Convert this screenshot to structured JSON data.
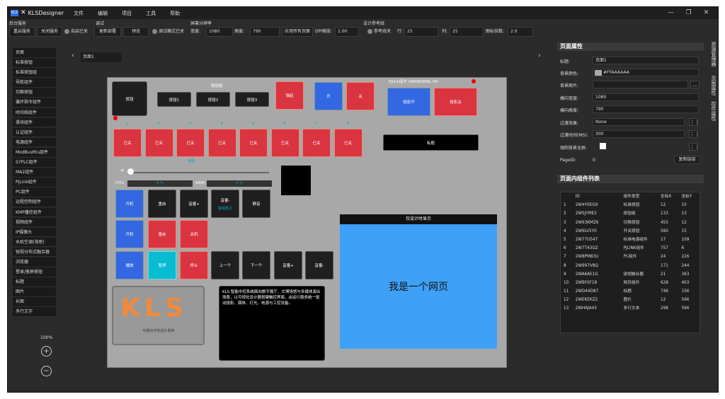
{
  "app": {
    "title": "KLSDesigner",
    "logo_text": "KLS",
    "menu": [
      "文件",
      "编辑",
      "项目",
      "工具",
      "帮助"
    ],
    "win_minimize": "—",
    "win_restore": "❐",
    "win_close": "✕"
  },
  "toolbar": {
    "service": {
      "label": "后台服务",
      "restart": "重启服务",
      "stop": "关闭服务",
      "auto_start": "自启已关"
    },
    "debug": {
      "label": "调试",
      "update_deploy": "更新部署",
      "preview": "预览",
      "debug_mode": "调试模式已关"
    },
    "resolution": {
      "label": "屏幕分辨率",
      "width_label": "宽度:",
      "width": "1080",
      "height_label": "高度:",
      "height": "790",
      "apply_all": "应用所有页面",
      "dpi_label": "DPI缩放:",
      "dpi": "1.00"
    },
    "guides": {
      "label": "设计参考线",
      "guides_toggle": "参考线关",
      "row_label": "行:",
      "rows": "25",
      "col_label": "列:",
      "cols": "25",
      "magnet_label": "图标倍数:",
      "magnet": "2.0"
    }
  },
  "sidebar": [
    "页面",
    "标准按钮",
    "标准按钮组",
    "导航组件",
    "切换按钮",
    "循环指令组件",
    "时间线组件",
    "滑块组件",
    "认证组件",
    "电源组件",
    "ModBusRtu组件",
    "S7PLC组件",
    "MA2组件",
    "PJLink组件",
    "PC组件",
    "远程控制组件",
    "KMP播控组件",
    "视频组件",
    "IP摄像头",
    "水机空调(海思)",
    "锐视分布式融合器",
    "浏览器",
    "登录/鉴屏按钮",
    "标题",
    "图片",
    "长图",
    "多行文字"
  ],
  "zoom": {
    "level": "100%",
    "in": "+",
    "out": "−"
  },
  "tabs": {
    "current": "页面1",
    "prev": "‹",
    "next": "›"
  },
  "canvas": {
    "btn_single": "按钮",
    "btn_group_title": "按钮组",
    "btn_group": [
      "按钮1",
      "按钮2",
      "按钮3"
    ],
    "popup": "弹起",
    "on": "开",
    "off": "关",
    "pjlink_status": "PJlink指令 UNKNOWNL 0H",
    "proj_on": "投影开",
    "proj_off": "投影关",
    "nums": [
      "1",
      "2",
      "3",
      "4",
      "5",
      "6",
      "7",
      "8"
    ],
    "states": [
      "已关",
      "已关",
      "已关",
      "已关",
      "已关",
      "已关",
      "已关",
      "已关"
    ],
    "power_label": "电源",
    "title_label": "标题",
    "cpu_label": "CPU:",
    "cpu_val": "0 %",
    "ram_label": "RAM:",
    "ram_val": "0 %",
    "pc_row1": [
      "开机",
      "重启",
      "音量+",
      "音量-",
      "静音"
    ],
    "volume_sub": "锐视盒子",
    "pc_row2": [
      "开机",
      "重启",
      "关机"
    ],
    "media_row": [
      "播放",
      "暂停",
      "停止",
      "上一个",
      "下一个",
      "音量+",
      "音量-"
    ],
    "browser_header": "仅设计时显示",
    "browser_text": "我是一个网页",
    "logo_text": "KLS",
    "logo_sub": "可视化中控设计系统",
    "multiline": "KLS 智能中控系统面向数字展厅、文博场馆与多媒体演出场景，以可视化设计器搭建触控界面，由运行服务统一驱动投影、媒体、灯光、电源与工控设备。"
  },
  "props": {
    "header": "页面属性",
    "title_label": "标题:",
    "title": "页面1",
    "bg_color_label": "背景颜色:",
    "bg_color": "#FFAAAAAA",
    "bg_image_label": "背景图片:",
    "bg_image": "",
    "browse": "...",
    "w_label": "横向宽度:",
    "w": "1080",
    "h_label": "横向高度:",
    "h": "790",
    "effect_label": "过渡效果:",
    "effect": "None",
    "dur_label": "过渡时间(MS):",
    "dur": "300",
    "full_label": "强制背景全屏:",
    "pageid_label": "PageID:",
    "pageid": "0",
    "copy_link": "复制链接"
  },
  "components": {
    "header": "页面内组件列表",
    "columns": [
      "",
      "ID",
      "组件类型",
      "坐标X",
      "坐标Y"
    ],
    "rows": [
      [
        "1",
        "2W4Y0EG9",
        "标准按钮",
        "12",
        "10"
      ],
      [
        "2",
        "2W5JYME2",
        "按钮组",
        "133",
        "13"
      ],
      [
        "3",
        "2W63KMZ6",
        "切换按钮",
        "455",
        "12"
      ],
      [
        "4",
        "2W6LV5Y0",
        "开关按钮",
        "560",
        "15"
      ],
      [
        "5",
        "2W77U547",
        "标准电源组件",
        "17",
        "109"
      ],
      [
        "6",
        "2W7T43OZ",
        "PJLINK组件",
        "757",
        "6"
      ],
      [
        "7",
        "2W8PM83U",
        "PC组件",
        "24",
        "226"
      ],
      [
        "8",
        "2W997V8Q",
        "",
        "171",
        "244"
      ],
      [
        "9",
        "2WA6AE1G",
        "锐视融合器",
        "21",
        "363"
      ],
      [
        "10",
        "2WBYSF18",
        "网页组件",
        "628",
        "403"
      ],
      [
        "11",
        "2WD44D87",
        "标题",
        "746",
        "156"
      ],
      [
        "12",
        "2WEKEKZ2",
        "图片",
        "12",
        "566"
      ],
      [
        "13",
        "2WHAJA43",
        "多行文本",
        "298",
        "566"
      ]
    ]
  },
  "vtabs": [
    "资源管理器",
    "页面属性",
    "控件属性"
  ],
  "colors": {
    "accent": "#3467e2",
    "danger": "#d9343f",
    "cyan": "#08bcd4",
    "browser": "#3fa0f7"
  }
}
